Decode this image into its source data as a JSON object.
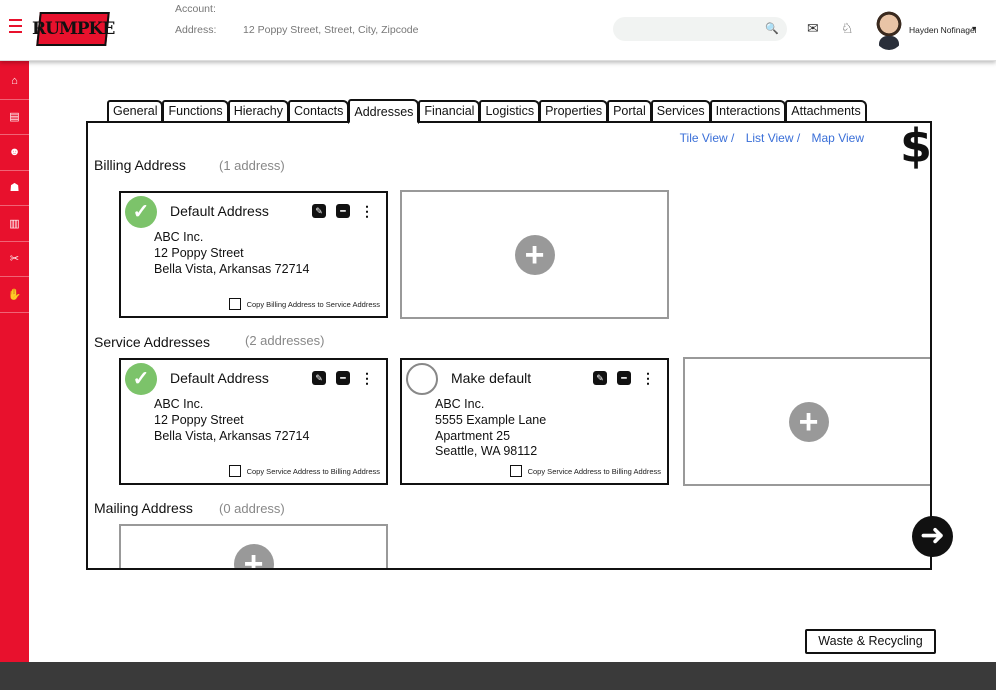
{
  "header": {
    "logo_text": "RUMPKE",
    "account_label": "Account:",
    "address_label": "Address:",
    "address_value": "12 Poppy Street, Street, City, Zipcode",
    "search_placeholder": "",
    "user_name": "Hayden Nofinagel"
  },
  "sidebar": {
    "items": [
      {
        "icon": "home-icon",
        "glyph": "⌂"
      },
      {
        "icon": "document-icon",
        "glyph": "▤"
      },
      {
        "icon": "user-icon",
        "glyph": "☻"
      },
      {
        "icon": "users-icon",
        "glyph": "☗"
      },
      {
        "icon": "chart-icon",
        "glyph": "▥"
      },
      {
        "icon": "tools-icon",
        "glyph": "✂"
      },
      {
        "icon": "thumbs-up-icon",
        "glyph": "✋"
      }
    ]
  },
  "tabs": [
    "General",
    "Functions",
    "Hierachy",
    "Contacts",
    "Addresses",
    "Financial",
    "Logistics",
    "Properties",
    "Portal",
    "Services",
    "Interactions",
    "Attachments"
  ],
  "active_tab": "Addresses",
  "views": {
    "tile": "Tile View /",
    "list": "List View /",
    "map": "Map View"
  },
  "currency_symbol": "$",
  "billing": {
    "title": "Billing Address",
    "count": "(1 address)",
    "card": {
      "title": "Default Address",
      "lines": [
        "ABC Inc.",
        "12 Poppy Street",
        "Bella Vista, Arkansas 72714"
      ],
      "copy_label": "Copy Billing Address to Service Address"
    }
  },
  "service": {
    "title": "Service Addresses",
    "count": "(2 addresses)",
    "cards": [
      {
        "title": "Default Address",
        "lines": [
          "ABC Inc.",
          "12 Poppy Street",
          "Bella Vista, Arkansas 72714"
        ],
        "copy_label": "Copy Service Address to Billing Address"
      },
      {
        "title": "Make default",
        "lines": [
          "ABC Inc.",
          "5555 Example Lane",
          "Apartment 25",
          "Seattle, WA 98112"
        ],
        "copy_label": "Copy Service Address to Billing Address"
      }
    ]
  },
  "mailing": {
    "title": "Mailing Address",
    "count": "(0 address)"
  },
  "waste_button": "Waste & Recycling",
  "colors": {
    "brand_red": "#e8112d",
    "check_green": "#7cc36a",
    "link_blue": "#3a6fd8",
    "footer": "#3a3a3a"
  }
}
